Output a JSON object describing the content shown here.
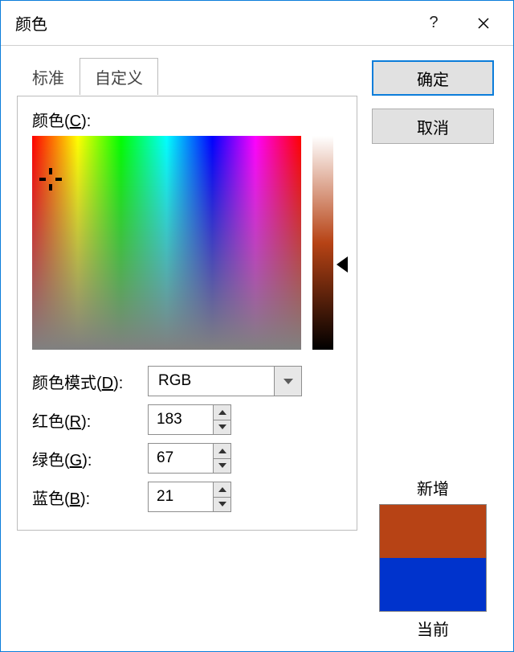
{
  "title": "颜色",
  "tabs": {
    "standard": "标准",
    "custom": "自定义"
  },
  "labels": {
    "colors": "颜色(",
    "colors_accel": "C",
    "colors_end": "):",
    "color_model": "颜色模式(",
    "color_model_accel": "D",
    "color_model_end": "):",
    "red": "红色(",
    "red_accel": "R",
    "red_end": "):",
    "green": "绿色(",
    "green_accel": "G",
    "green_end": "):",
    "blue": "蓝色(",
    "blue_accel": "B",
    "blue_end": "):"
  },
  "color_model_value": "RGB",
  "rgb": {
    "r": "183",
    "g": "67",
    "b": "21"
  },
  "buttons": {
    "ok": "确定",
    "cancel": "取消"
  },
  "preview": {
    "new_label": "新增",
    "current_label": "当前",
    "new_color": "#b74315",
    "current_color": "#0033cc"
  }
}
